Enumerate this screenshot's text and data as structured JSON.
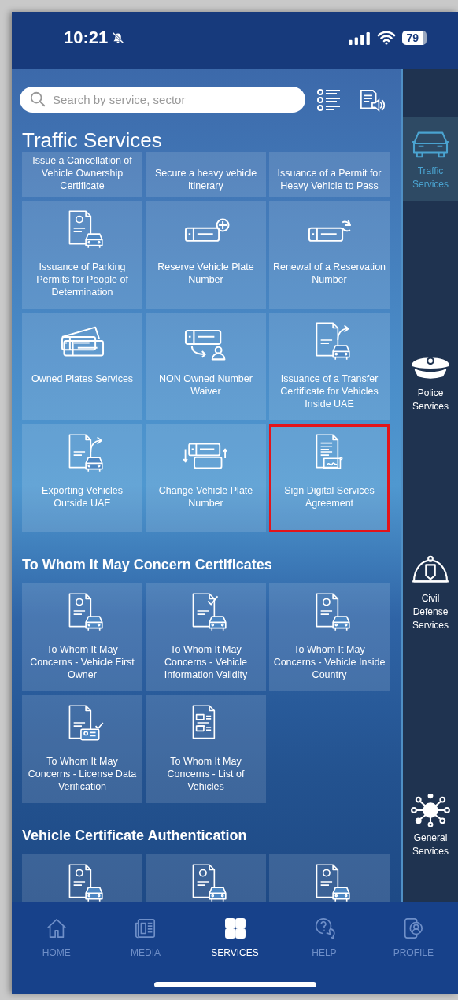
{
  "status_bar": {
    "time": "10:21",
    "silent": true,
    "battery": "79"
  },
  "search": {
    "placeholder": "Search by service, sector"
  },
  "sections": [
    {
      "title": "Traffic Services",
      "kind": "main",
      "tiles": [
        {
          "label": "Issue a Cancellation of Vehicle Ownership Certificate",
          "highlighted": false
        },
        {
          "label": "Secure a heavy vehicle itinerary",
          "highlighted": false
        },
        {
          "label": "Issuance of a Permit for Heavy Vehicle to Pass",
          "highlighted": false
        },
        {
          "label": "Issuance of Parking Permits for People of Determination",
          "kind": "doc-car",
          "highlighted": false
        },
        {
          "label": "Reserve Vehicle Plate Number",
          "kind": "plate-plus",
          "highlighted": false
        },
        {
          "label": "Renewal of a Reservation Number",
          "kind": "plate-renew",
          "highlighted": false
        },
        {
          "label": "Owned Plates Services",
          "kind": "plates",
          "highlighted": false
        },
        {
          "label": "NON Owned Number Waiver",
          "kind": "plate-person",
          "highlighted": false
        },
        {
          "label": "Issuance of a Transfer Certificate for Vehicles Inside UAE",
          "kind": "doc-car-arrow",
          "highlighted": false
        },
        {
          "label": "Exporting Vehicles Outside UAE",
          "kind": "doc-car-arrow",
          "highlighted": false
        },
        {
          "label": "Change Vehicle Plate Number",
          "kind": "plate-swap",
          "highlighted": false
        },
        {
          "label": "Sign Digital Services Agreement",
          "kind": "doc-sign",
          "highlighted": true
        }
      ]
    },
    {
      "title": "To Whom it May Concern Certificates",
      "kind": "sub",
      "tiles": [
        {
          "label": "To Whom It May Concerns - Vehicle First Owner",
          "kind": "doc-car",
          "highlighted": false
        },
        {
          "label": "To Whom It May Concerns - Vehicle Information Validity",
          "kind": "doc-check-car",
          "highlighted": false
        },
        {
          "label": "To Whom It May Concerns - Vehicle Inside Country",
          "kind": "doc-car",
          "highlighted": false
        },
        {
          "label": "To Whom It May Concerns - License Data Verification",
          "kind": "doc-card",
          "highlighted": false
        },
        {
          "label": "To Whom It May Concerns - List of Vehicles",
          "kind": "doc-cars",
          "highlighted": false
        }
      ]
    },
    {
      "title": "Vehicle Certificate Authentication",
      "kind": "sub",
      "tiles": [
        {
          "kind": "doc-car",
          "highlighted": false
        },
        {
          "kind": "doc-car",
          "highlighted": false
        },
        {
          "kind": "doc-car",
          "highlighted": false
        }
      ]
    }
  ],
  "sidebar": {
    "items": [
      {
        "label": "Traffic Services",
        "kind": "car",
        "selected": true
      },
      {
        "label": "Police Services",
        "kind": "police-cap",
        "selected": false
      },
      {
        "label": "Civil Defense Services",
        "kind": "helmet",
        "selected": false
      },
      {
        "label": "General Services",
        "kind": "network",
        "selected": false
      }
    ]
  },
  "nav": {
    "items": [
      {
        "label": "HOME",
        "kind": "home",
        "selected": false
      },
      {
        "label": "MEDIA",
        "kind": "newspaper",
        "selected": false
      },
      {
        "label": "SERVICES",
        "kind": "grid",
        "selected": true
      },
      {
        "label": "HELP",
        "kind": "help",
        "selected": false
      },
      {
        "label": "PROFILE",
        "kind": "profile",
        "selected": false
      }
    ]
  }
}
